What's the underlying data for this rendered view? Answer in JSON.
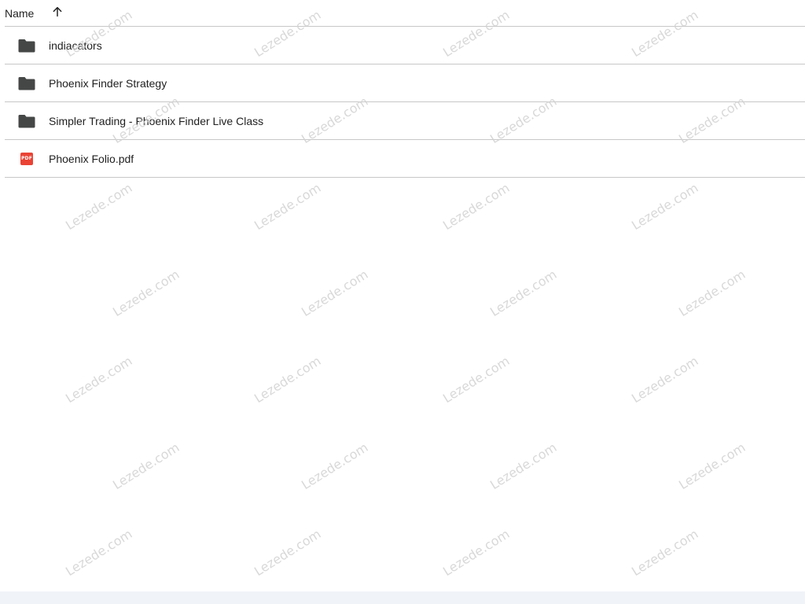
{
  "header": {
    "name_label": "Name",
    "sort_icon": "arrow-up-icon"
  },
  "files": [
    {
      "name": "indiacators",
      "type": "folder",
      "icon": "folder-icon"
    },
    {
      "name": "Phoenix Finder Strategy",
      "type": "folder",
      "icon": "folder-icon"
    },
    {
      "name": "Simpler Trading - Phoenix Finder Live Class",
      "type": "folder",
      "icon": "folder-icon"
    },
    {
      "name": "Phoenix Folio.pdf",
      "type": "pdf",
      "icon": "pdf-icon",
      "icon_label": "PDF"
    }
  ],
  "watermark": {
    "text": "Lezede.com"
  },
  "colors": {
    "folder": "#444746",
    "pdf": "#ea4335",
    "divider": "#c7c7c7",
    "watermark": "#d2d2d2"
  }
}
